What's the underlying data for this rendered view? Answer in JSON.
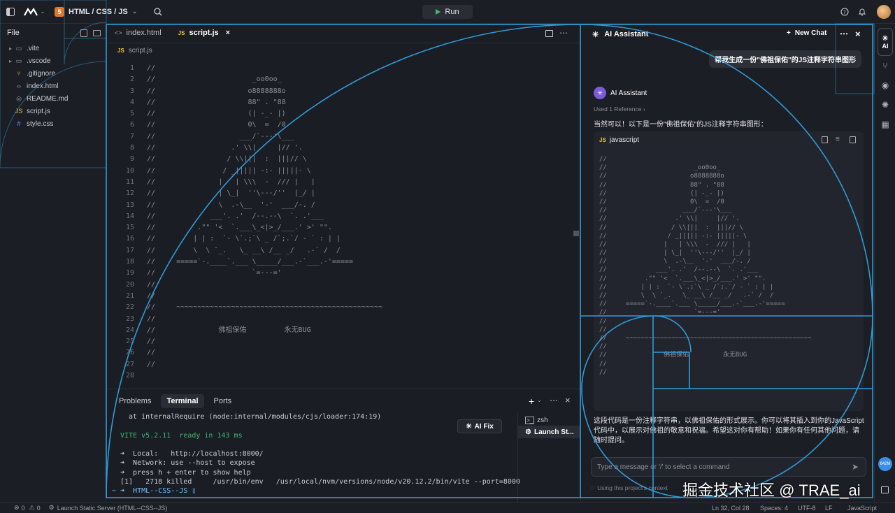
{
  "topbar": {
    "project": "HTML / CSS / JS",
    "run_label": "Run"
  },
  "explorer": {
    "title": "File",
    "items": [
      {
        "name": ".vite",
        "type": "folder"
      },
      {
        "name": ".vscode",
        "type": "folder"
      },
      {
        "name": ".gitignore",
        "type": "git"
      },
      {
        "name": "index.html",
        "type": "html"
      },
      {
        "name": "README.md",
        "type": "md"
      },
      {
        "name": "script.js",
        "type": "js"
      },
      {
        "name": "style.css",
        "type": "css"
      }
    ]
  },
  "editor": {
    "tabs": [
      {
        "label": "index.html",
        "icon": "<>"
      },
      {
        "label": "script.js",
        "icon": "JS"
      }
    ],
    "breadcrumb": "script.js",
    "lines": [
      "//",
      "//                       _oo0oo_",
      "//                      o8888888o",
      "//                      88\" . \"88",
      "//                      (| -_- |)",
      "//                      0\\  =  /0",
      "//                    ___/`---'\\___",
      "//                  .' \\\\|     |// '.",
      "//                 / \\\\|||  :  |||// \\",
      "//                / _||||| -:- |||||- \\",
      "//               |   | \\\\\\  -  /// |   |",
      "//               | \\_|  ''\\---/''  |_/ |",
      "//               \\  .-\\__  '-'  ___/-. /",
      "//             ___'. .'  /--.--\\  `. .'___",
      "//          .\"\" '<  `.___\\_<|>_/___.' >' \"\".",
      "//         | | :  `- \\`.;`\\ _ /`;.`/ - ` : | |",
      "//         \\  \\ `_.   \\_ __\\ /__ _/   .-` /  /",
      "//     =====`-.____`.___ \\_____/___.-`___.-'=====",
      "//                       `=---='",
      "//",
      "//",
      "//     ~~~~~~~~~~~~~~~~~~~~~~~~~~~~~~~~~~~~~~~~~~~~~~~~~",
      "//",
      "//               佛祖保佑         永无BUG",
      "//",
      "//",
      "//",
      ""
    ]
  },
  "panel": {
    "tabs": [
      "Problems",
      "Terminal",
      "Ports"
    ],
    "active_tab": "Terminal",
    "ai_fix": "AI Fix",
    "sessions": [
      "zsh",
      "Launch St..."
    ],
    "terminal": [
      "  at internalRequire (node:internal/modules/cjs/loader:174:19)",
      "",
      "VITE v5.2.11  ready in 143 ms",
      "",
      "➜  Local:   http://localhost:8000/",
      "➜  Network: use --host to expose",
      "➜  press h + enter to show help",
      "[1]   2718 killed     /usr/bin/env   /usr/local/nvm/versions/node/v20.12.2/bin/vite --port=8000",
      "~ ➜  HTML--CSS--JS ▯"
    ]
  },
  "ai": {
    "title": "AI Assistant",
    "new_chat": "New Chat",
    "user_message": "帮我生成一份\"佛祖保佑\"的JS注释字符串图形",
    "assistant_name": "AI Assistant",
    "reference": "Used 1 Reference",
    "intro": "当然可以！以下是一份\"佛祖保佑\"的JS注释字符串图形：",
    "code_lang": "javascript",
    "code_lines": [
      "//",
      "//                       _oo0oo_",
      "//                      o8888888o",
      "//                      88\" . \"88",
      "//                      (| -_- |)",
      "//                      0\\  =  /0",
      "//                    ___/`---'\\___",
      "//                  .' \\\\|     |// '.",
      "//                 / \\\\|||  :  |||// \\",
      "//                / _||||| -:- |||||- \\",
      "//               |   | \\\\\\  -  /// |   |",
      "//               | \\_|  ''\\---/''  |_/ |",
      "//               \\  .-\\__  '-'  ___/-. /",
      "//             ___'. .'  /--.--\\  `. .'___",
      "//          .\"\" '<  `.___\\_<|>_/___.' >' \"\".",
      "//         | | :  `- \\`.;`\\ _ /`;.`/ - ` : | |",
      "//         \\  \\ `_.   \\_ __\\ /__ _/   .-` /  /",
      "//     =====`-.____`.___ \\_____/___.-`___.-'=====",
      "//                       `=---='",
      "//",
      "//",
      "//     ~~~~~~~~~~~~~~~~~~~~~~~~~~~~~~~~~~~~~~~~~~~~~~~~~",
      "//",
      "//               佛祖保佑         永无BUG",
      "//",
      "//"
    ],
    "outro": "这段代码是一份注释字符串，以佛祖保佑的形式展示。你可以将其插入到你的JavaScript代码中，以展示对佛祖的敬意和祝福。希望这对你有帮助！如果你有任何其他问题，请随时提问。",
    "input_placeholder": "Type a message or '/' to select a command",
    "context_hint": "Using this project's context"
  },
  "rail": {
    "ai_label": "AI",
    "badge": "642M"
  },
  "status": {
    "problems": "0",
    "warnings": "0",
    "task": "Launch Static Server (HTML--CSS--JS)",
    "position": "Ln 32, Col 28",
    "spaces": "Spaces: 4",
    "encoding": "UTF-8",
    "eol": "LF",
    "language": "JavaScript"
  },
  "watermark": "掘金技术社区 @ TRAE_ai"
}
